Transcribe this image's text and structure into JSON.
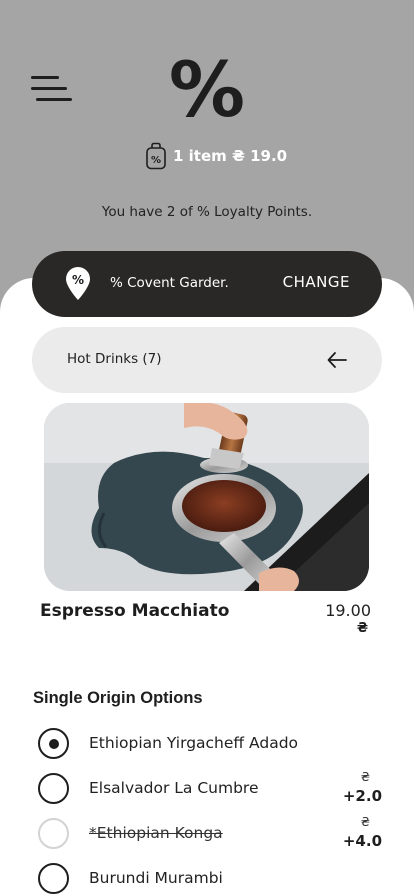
{
  "header": {
    "logo_text": "%",
    "cart_summary": "1 item ₴ 19.0",
    "loyalty_text": "You have 2 of % Loyalty Points."
  },
  "store": {
    "pin_glyph": "%",
    "name": "% Covent Garder.",
    "change_label": "CHANGE"
  },
  "category": {
    "label": "Hot Drinks (7)"
  },
  "product": {
    "name": "Espresso Macchiato",
    "price": "19.00",
    "currency": "₴"
  },
  "options": {
    "title": "Single Origin Options",
    "items": [
      {
        "label": "Ethiopian Yirgacheff Adado",
        "selected": true,
        "disabled": false,
        "currency": "",
        "price": ""
      },
      {
        "label": "Elsalvador La Cumbre",
        "selected": false,
        "disabled": false,
        "currency": "₴",
        "price": "+2.0"
      },
      {
        "label": "*Ethiopian Konga",
        "selected": false,
        "disabled": true,
        "currency": "₴",
        "price": "+4.0"
      },
      {
        "label": "Burundi Murambi",
        "selected": false,
        "disabled": false,
        "currency": "",
        "price": ""
      }
    ]
  },
  "colors": {
    "header_bg": "#a5a5a5",
    "dark": "#2a2727",
    "pill_light": "#ebebeb"
  },
  "icons": [
    "menu-icon",
    "shopping-bag-icon",
    "location-pin-icon",
    "arrow-left-icon"
  ]
}
